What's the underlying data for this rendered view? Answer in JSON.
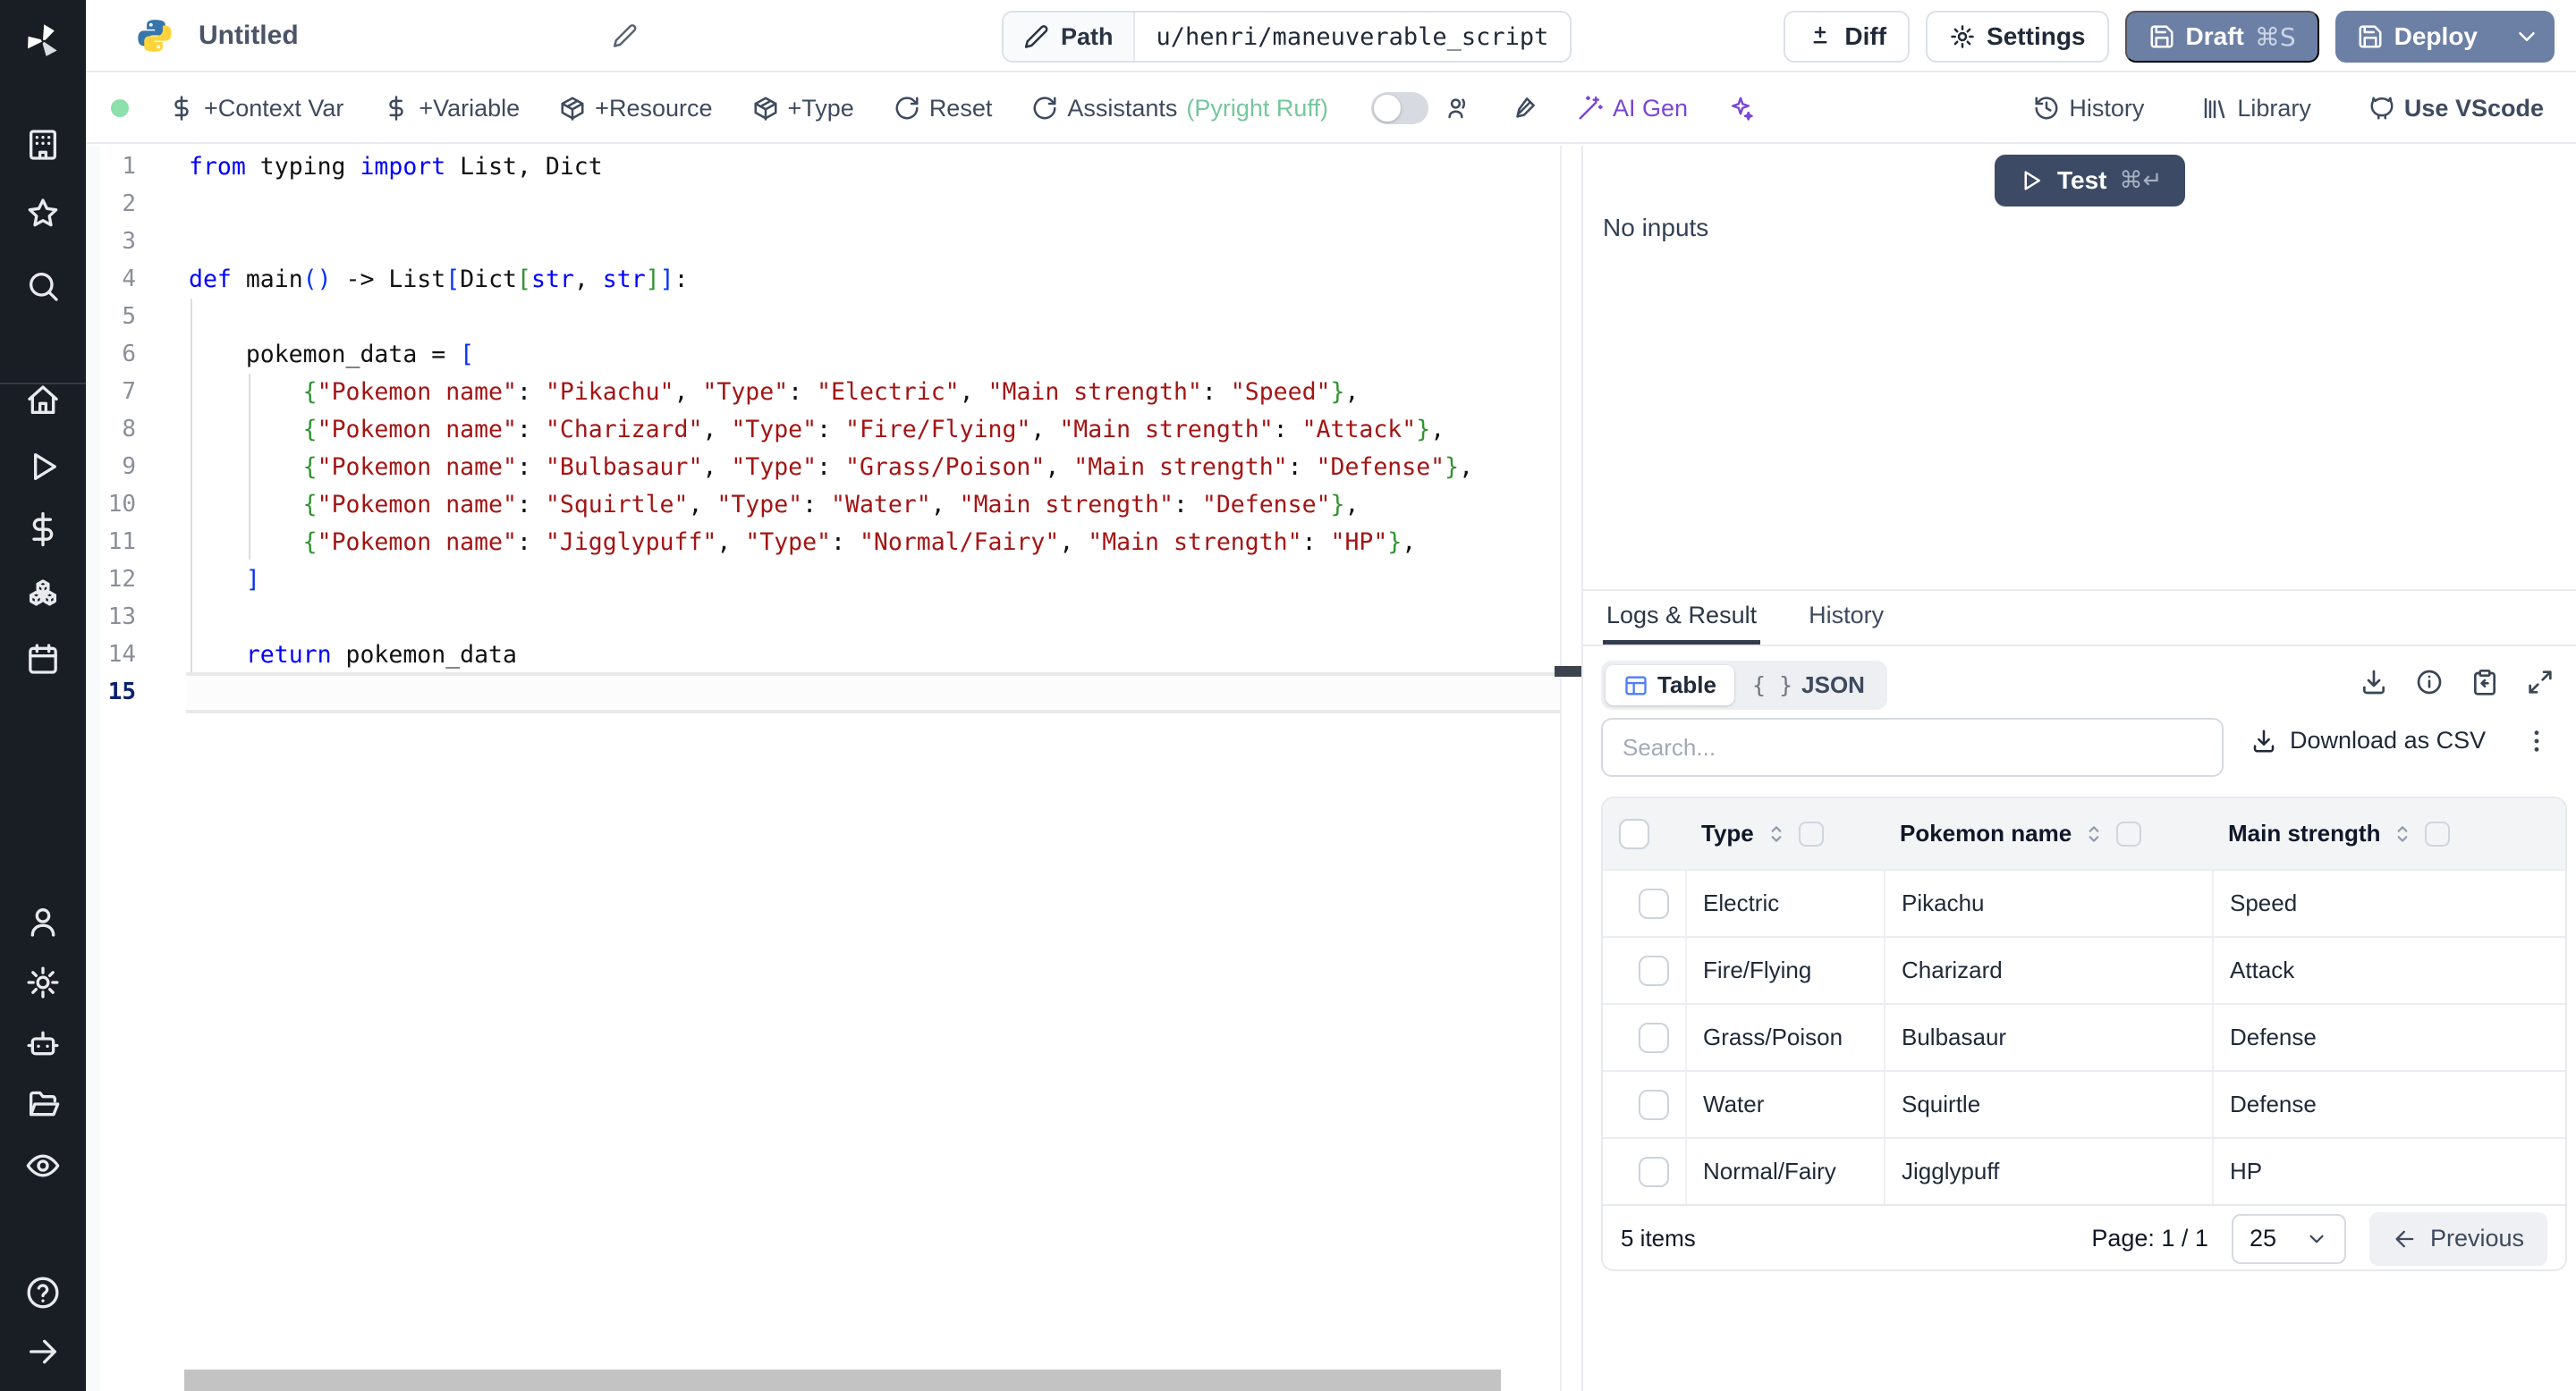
{
  "header": {
    "title": "Untitled",
    "path_label": "Path",
    "path_value": "u/henri/maneuverable_script",
    "diff_label": "Diff",
    "settings_label": "Settings",
    "draft_label": "Draft",
    "draft_shortcut": "⌘S",
    "deploy_label": "Deploy"
  },
  "toolbar": {
    "context_var": "+Context Var",
    "variable": "+Variable",
    "resource": "+Resource",
    "type": "+Type",
    "reset": "Reset",
    "assistants": "Assistants",
    "assistants_status": "(Pyright Ruff)",
    "ai_gen": "AI Gen",
    "history": "History",
    "library": "Library",
    "vscode": "Use VScode"
  },
  "editor": {
    "language": "python",
    "lines": [
      {
        "num": "1",
        "segments": [
          [
            "kw",
            "from"
          ],
          [
            "pl",
            " typing "
          ],
          [
            "kw",
            "import"
          ],
          [
            "pl",
            " List, Dict"
          ]
        ]
      },
      {
        "num": "2",
        "segments": []
      },
      {
        "num": "3",
        "segments": []
      },
      {
        "num": "4",
        "segments": [
          [
            "kw",
            "def"
          ],
          [
            "pl",
            " main"
          ],
          [
            "b1",
            "()"
          ],
          [
            "pl",
            " -> List"
          ],
          [
            "b1",
            "["
          ],
          [
            "pl",
            "Dict"
          ],
          [
            "b2",
            "["
          ],
          [
            "kw",
            "str"
          ],
          [
            "pl",
            ", "
          ],
          [
            "kw",
            "str"
          ],
          [
            "b2",
            "]"
          ],
          [
            "b1",
            "]"
          ],
          [
            "pl",
            ":"
          ]
        ]
      },
      {
        "num": "5",
        "segments": []
      },
      {
        "num": "6",
        "segments": [
          [
            "pl",
            "    pokemon_data = "
          ],
          [
            "b1",
            "["
          ]
        ]
      },
      {
        "num": "7",
        "segments": [
          [
            "pl",
            "        "
          ],
          [
            "b2",
            "{"
          ],
          [
            "st",
            "\"Pokemon name\""
          ],
          [
            "pl",
            ": "
          ],
          [
            "st",
            "\"Pikachu\""
          ],
          [
            "pl",
            ", "
          ],
          [
            "st",
            "\"Type\""
          ],
          [
            "pl",
            ": "
          ],
          [
            "st",
            "\"Electric\""
          ],
          [
            "pl",
            ", "
          ],
          [
            "st",
            "\"Main strength\""
          ],
          [
            "pl",
            ": "
          ],
          [
            "st",
            "\"Speed\""
          ],
          [
            "b2",
            "}"
          ],
          [
            "pl",
            ","
          ]
        ]
      },
      {
        "num": "8",
        "segments": [
          [
            "pl",
            "        "
          ],
          [
            "b2",
            "{"
          ],
          [
            "st",
            "\"Pokemon name\""
          ],
          [
            "pl",
            ": "
          ],
          [
            "st",
            "\"Charizard\""
          ],
          [
            "pl",
            ", "
          ],
          [
            "st",
            "\"Type\""
          ],
          [
            "pl",
            ": "
          ],
          [
            "st",
            "\"Fire/Flying\""
          ],
          [
            "pl",
            ", "
          ],
          [
            "st",
            "\"Main strength\""
          ],
          [
            "pl",
            ": "
          ],
          [
            "st",
            "\"Attack\""
          ],
          [
            "b2",
            "}"
          ],
          [
            "pl",
            ","
          ]
        ]
      },
      {
        "num": "9",
        "segments": [
          [
            "pl",
            "        "
          ],
          [
            "b2",
            "{"
          ],
          [
            "st",
            "\"Pokemon name\""
          ],
          [
            "pl",
            ": "
          ],
          [
            "st",
            "\"Bulbasaur\""
          ],
          [
            "pl",
            ", "
          ],
          [
            "st",
            "\"Type\""
          ],
          [
            "pl",
            ": "
          ],
          [
            "st",
            "\"Grass/Poison\""
          ],
          [
            "pl",
            ", "
          ],
          [
            "st",
            "\"Main strength\""
          ],
          [
            "pl",
            ": "
          ],
          [
            "st",
            "\"Defense\""
          ],
          [
            "b2",
            "}"
          ],
          [
            "pl",
            ","
          ]
        ]
      },
      {
        "num": "10",
        "segments": [
          [
            "pl",
            "        "
          ],
          [
            "b2",
            "{"
          ],
          [
            "st",
            "\"Pokemon name\""
          ],
          [
            "pl",
            ": "
          ],
          [
            "st",
            "\"Squirtle\""
          ],
          [
            "pl",
            ", "
          ],
          [
            "st",
            "\"Type\""
          ],
          [
            "pl",
            ": "
          ],
          [
            "st",
            "\"Water\""
          ],
          [
            "pl",
            ", "
          ],
          [
            "st",
            "\"Main strength\""
          ],
          [
            "pl",
            ": "
          ],
          [
            "st",
            "\"Defense\""
          ],
          [
            "b2",
            "}"
          ],
          [
            "pl",
            ","
          ]
        ]
      },
      {
        "num": "11",
        "segments": [
          [
            "pl",
            "        "
          ],
          [
            "b2",
            "{"
          ],
          [
            "st",
            "\"Pokemon name\""
          ],
          [
            "pl",
            ": "
          ],
          [
            "st",
            "\"Jigglypuff\""
          ],
          [
            "pl",
            ", "
          ],
          [
            "st",
            "\"Type\""
          ],
          [
            "pl",
            ": "
          ],
          [
            "st",
            "\"Normal/Fairy\""
          ],
          [
            "pl",
            ", "
          ],
          [
            "st",
            "\"Main strength\""
          ],
          [
            "pl",
            ": "
          ],
          [
            "st",
            "\"HP\""
          ],
          [
            "b2",
            "}"
          ],
          [
            "pl",
            ","
          ]
        ]
      },
      {
        "num": "12",
        "segments": [
          [
            "pl",
            "    "
          ],
          [
            "b1",
            "]"
          ]
        ]
      },
      {
        "num": "13",
        "segments": []
      },
      {
        "num": "14",
        "segments": [
          [
            "pl",
            "    "
          ],
          [
            "kw",
            "return"
          ],
          [
            "pl",
            " pokemon_data"
          ]
        ]
      },
      {
        "num": "15",
        "segments": [],
        "active": true
      }
    ]
  },
  "run_panel": {
    "test_label": "Test",
    "test_shortcut": "⌘↵",
    "no_inputs": "No inputs"
  },
  "result_panel": {
    "tabs": {
      "logs": "Logs & Result",
      "history": "History"
    },
    "view_toggle": {
      "table": "Table",
      "json": "JSON",
      "json_braces": "{ }"
    },
    "search_placeholder": "Search...",
    "download_csv": "Download as CSV",
    "table": {
      "columns": [
        "Type",
        "Pokemon name",
        "Main strength"
      ],
      "rows": [
        [
          "Electric",
          "Pikachu",
          "Speed"
        ],
        [
          "Fire/Flying",
          "Charizard",
          "Attack"
        ],
        [
          "Grass/Poison",
          "Bulbasaur",
          "Defense"
        ],
        [
          "Water",
          "Squirtle",
          "Defense"
        ],
        [
          "Normal/Fairy",
          "Jigglypuff",
          "HP"
        ]
      ]
    },
    "footer": {
      "count": "5 items",
      "page": "Page: 1 / 1",
      "page_size": "25",
      "previous": "Previous"
    }
  },
  "colors": {
    "accent_slate_button": "#6c7fa5",
    "test_button": "#3d4a66",
    "sidebar_bg": "#191d24",
    "status_green": "#8ce0ab",
    "ai_purple": "#7a46d6",
    "assistant_green": "#74c79c",
    "code_keyword": "#0000ff",
    "code_string": "#a31515",
    "bracket_l1": "#0431fa",
    "bracket_l2": "#319331"
  }
}
